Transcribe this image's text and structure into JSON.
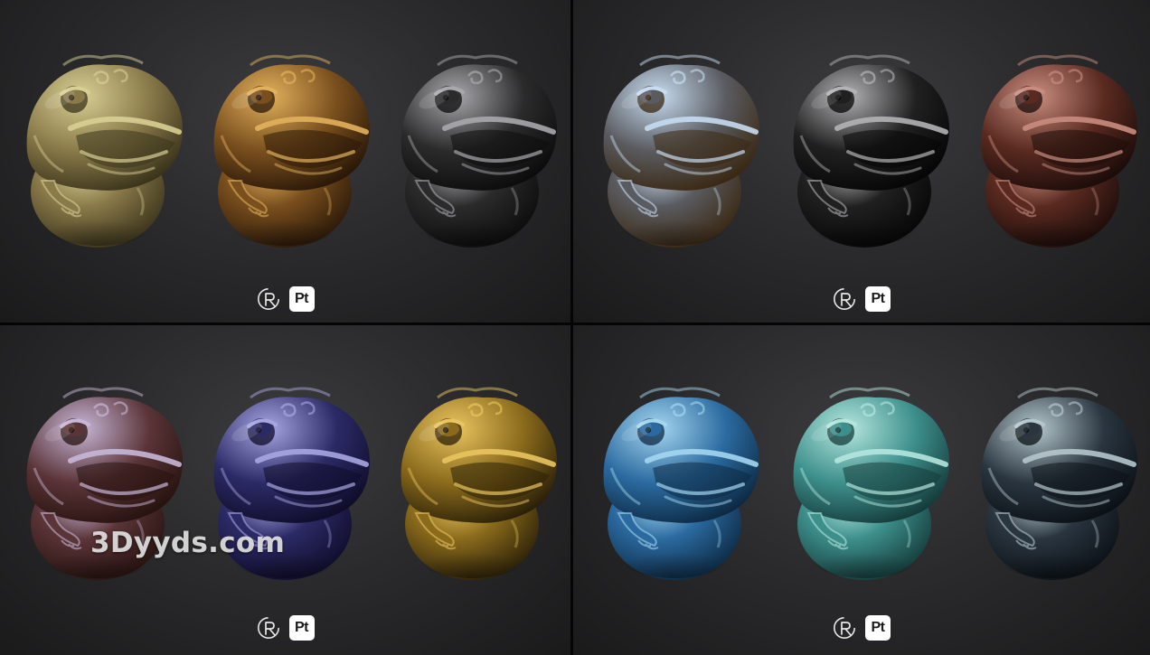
{
  "watermark": "3Dyyds.com",
  "logo_pt_label": "Pt",
  "panels": [
    {
      "position": "top-left",
      "toads": [
        {
          "material": "pale-brass",
          "base": "#8a7a4a",
          "light": "#d8cf94",
          "dark": "#3b341c"
        },
        {
          "material": "polished-bronze",
          "base": "#7a4f1e",
          "light": "#e2b15c",
          "dark": "#2a1808"
        },
        {
          "material": "dark-iron",
          "base": "#2b2b2c",
          "light": "#a9a9ad",
          "dark": "#0c0c0d"
        }
      ]
    },
    {
      "position": "top-right",
      "toads": [
        {
          "material": "blue-steel-bronze",
          "base": "#5a5b60",
          "light": "#c7dcf1",
          "dark": "#3a2812"
        },
        {
          "material": "black-chrome",
          "base": "#202021",
          "light": "#b3b3b5",
          "dark": "#060606"
        },
        {
          "material": "rusted-red-iron",
          "base": "#5a2a20",
          "light": "#c98d80",
          "dark": "#1c0c0a"
        }
      ]
    },
    {
      "position": "bottom-left",
      "toads": [
        {
          "material": "iridescent-copper",
          "base": "#5b3438",
          "light": "#c7b7d8",
          "dark": "#27130f"
        },
        {
          "material": "iridescent-blue",
          "base": "#2c2a66",
          "light": "#a7a6e2",
          "dark": "#0f0d2a"
        },
        {
          "material": "gold-patina",
          "base": "#8a6a1c",
          "light": "#e9c45f",
          "dark": "#2c2108"
        }
      ]
    },
    {
      "position": "bottom-right",
      "toads": [
        {
          "material": "blue-painted-copper",
          "base": "#2b6aa0",
          "light": "#a4d6ef",
          "dark": "#0d2a44"
        },
        {
          "material": "teal-painted-copper",
          "base": "#3d8f8c",
          "light": "#b5e6de",
          "dark": "#153c3b"
        },
        {
          "material": "weathered-slate",
          "base": "#2a3540",
          "light": "#b4c7cc",
          "dark": "#0b1116"
        }
      ]
    }
  ],
  "icons": {
    "substance": "substance-3d-logo-icon",
    "painter": "substance-painter-logo-icon"
  }
}
